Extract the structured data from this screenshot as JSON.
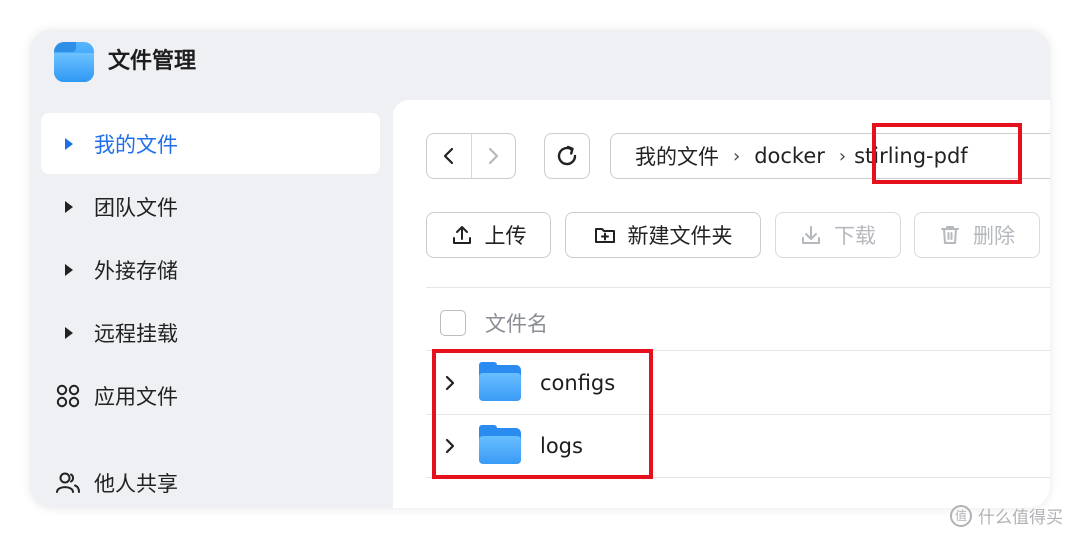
{
  "app": {
    "title": "文件管理"
  },
  "sidebar": {
    "items": [
      {
        "label": "我的文件",
        "active": true
      },
      {
        "label": "团队文件"
      },
      {
        "label": "外接存储"
      },
      {
        "label": "远程挂载"
      },
      {
        "label": "应用文件",
        "icon": "app-grid-icon"
      },
      {
        "label": "他人共享",
        "icon": "users-icon"
      }
    ]
  },
  "breadcrumb": {
    "items": [
      "我的文件",
      "docker",
      "stirling-pdf"
    ],
    "separator": "›"
  },
  "toolbar": {
    "upload": "上传",
    "new_folder": "新建文件夹",
    "download": "下载",
    "delete": "删除"
  },
  "table": {
    "header": "文件名",
    "rows": [
      {
        "name": "configs"
      },
      {
        "name": "logs"
      }
    ]
  },
  "watermark": {
    "text": "什么值得买",
    "icon": "值"
  },
  "colors": {
    "accent": "#1f6fe8",
    "highlight": "#e5121e",
    "folder": "#2a8cf0"
  }
}
